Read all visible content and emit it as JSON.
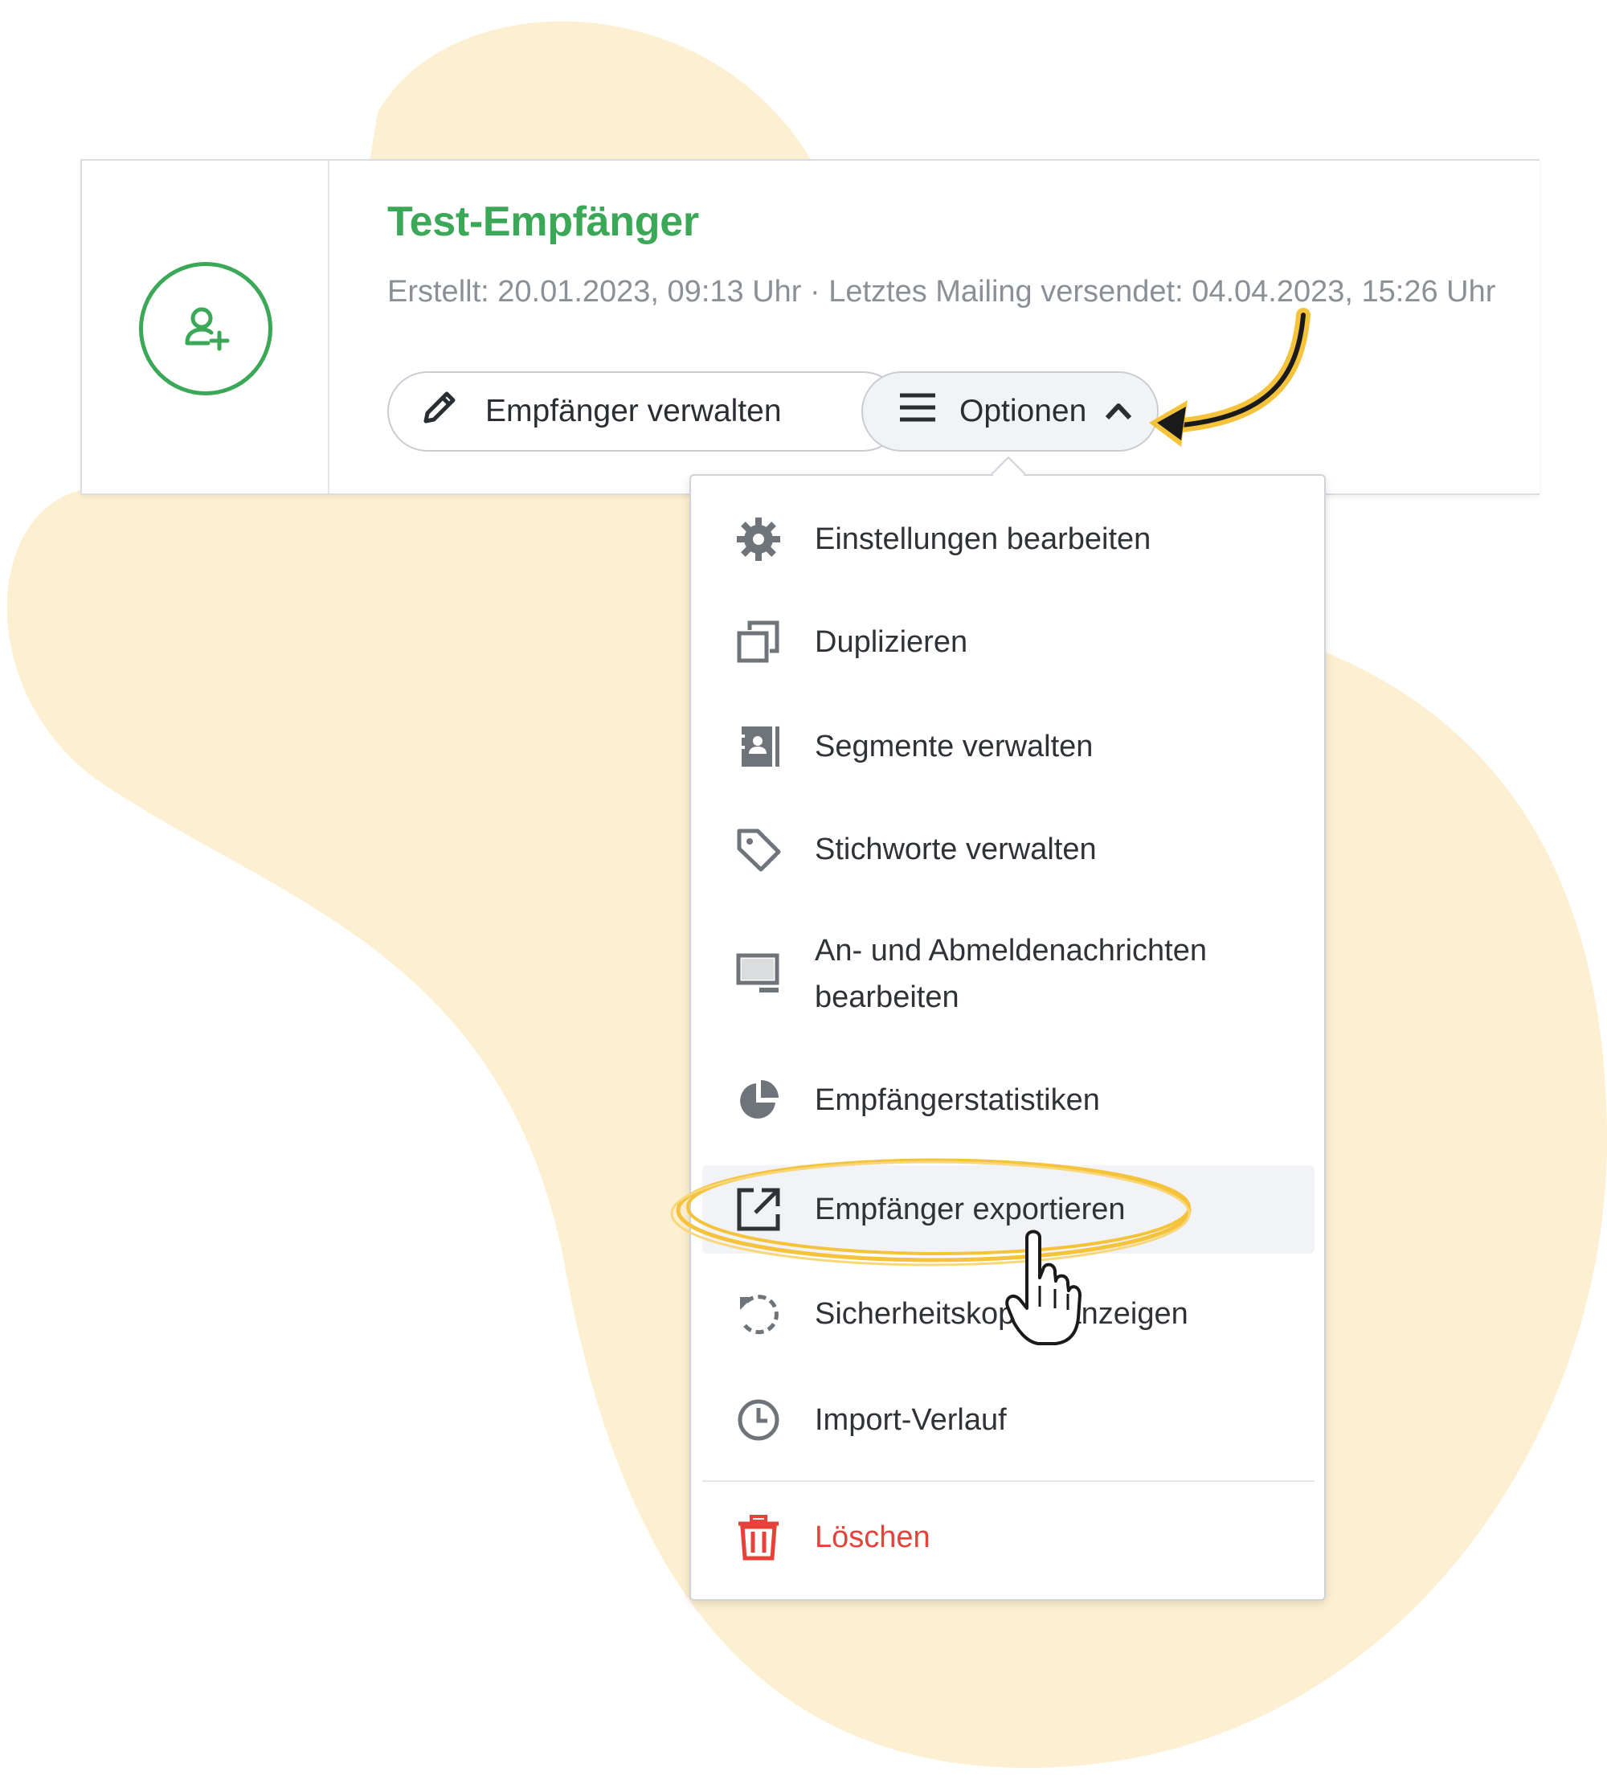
{
  "card": {
    "title": "Test-Empfänger",
    "meta": "Erstellt: 20.01.2023, 09:13 Uhr · Letztes Mailing versendet: 04.04.2023, 15:26 Uhr",
    "manage_button": "Empfänger verwalten",
    "options_button": "Optionen"
  },
  "menu": {
    "items": [
      {
        "label": "Einstellungen bearbeiten",
        "icon": "gear-icon"
      },
      {
        "label": "Duplizieren",
        "icon": "duplicate-icon"
      },
      {
        "label": "Segmente verwalten",
        "icon": "contacts-book-icon"
      },
      {
        "label": "Stichworte verwalten",
        "icon": "tag-icon"
      },
      {
        "label": "An- und Abmeldenachrichten bearbeiten",
        "icon": "monitor-icon"
      },
      {
        "label": "Empfängerstatistiken",
        "icon": "pie-chart-icon"
      },
      {
        "label": "Empfänger exportieren",
        "icon": "export-icon",
        "highlighted": true
      },
      {
        "label": "Sicherheitskopien anzeigen",
        "icon": "restore-icon"
      },
      {
        "label": "Import-Verlauf",
        "icon": "clock-icon"
      },
      {
        "label": "Löschen",
        "icon": "trash-icon"
      }
    ]
  },
  "colors": {
    "brand_green": "#3aa856",
    "danger_red": "#e8413a",
    "annotation_yellow": "#f5c33b",
    "background_blob": "#fdf0d2"
  }
}
